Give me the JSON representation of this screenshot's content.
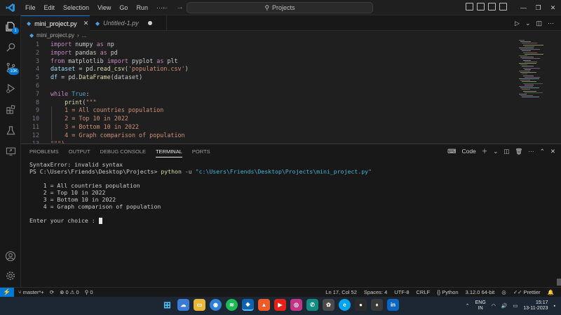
{
  "titlebar": {
    "menu": [
      "File",
      "Edit",
      "Selection",
      "View",
      "Go",
      "Run",
      "···"
    ],
    "search": "Projects"
  },
  "activity": {
    "explorer_badge": "1",
    "scm_badge": "10K"
  },
  "tabs": [
    {
      "label": "mini_project.py",
      "active": true
    },
    {
      "label": "Untitled-1.py",
      "active": false,
      "dirty": true
    }
  ],
  "breadcrumb": {
    "file": "mini_project.py",
    "more": "..."
  },
  "editor": {
    "lines": [
      {
        "n": "1",
        "tokens": [
          [
            "kw",
            "import"
          ],
          [
            "t",
            " numpy "
          ],
          [
            "kw",
            "as"
          ],
          [
            "t",
            " np"
          ]
        ]
      },
      {
        "n": "2",
        "tokens": [
          [
            "kw",
            "import"
          ],
          [
            "t",
            " pandas "
          ],
          [
            "kw",
            "as"
          ],
          [
            "t",
            " pd"
          ]
        ]
      },
      {
        "n": "3",
        "tokens": [
          [
            "kw",
            "from"
          ],
          [
            "t",
            " matplotlib "
          ],
          [
            "kw",
            "import"
          ],
          [
            "t",
            " pyplot "
          ],
          [
            "kw",
            "as"
          ],
          [
            "t",
            " plt"
          ]
        ]
      },
      {
        "n": "4",
        "tokens": [
          [
            "var",
            "dataset"
          ],
          [
            "t",
            " = pd."
          ],
          [
            "fn",
            "read_csv"
          ],
          [
            "t",
            "("
          ],
          [
            "str",
            "'population.csv'"
          ],
          [
            "t",
            ")"
          ]
        ]
      },
      {
        "n": "5",
        "tokens": [
          [
            "var",
            "df"
          ],
          [
            "t",
            " = pd."
          ],
          [
            "fn",
            "DataFrame"
          ],
          [
            "t",
            "(dataset)"
          ]
        ]
      },
      {
        "n": "6",
        "tokens": []
      },
      {
        "n": "7",
        "tokens": [
          [
            "kw",
            "while"
          ],
          [
            "t",
            " "
          ],
          [
            "kwb",
            "True"
          ],
          [
            "t",
            ":"
          ]
        ]
      },
      {
        "n": "8",
        "tokens": [
          [
            "t",
            "    "
          ],
          [
            "fn",
            "print"
          ],
          [
            "t",
            "("
          ],
          [
            "str",
            "\"\"\""
          ]
        ]
      },
      {
        "n": "9",
        "tokens": [
          [
            "str",
            "    1 = All countries population"
          ]
        ]
      },
      {
        "n": "10",
        "tokens": [
          [
            "str",
            "    2 = Top 10 in 2022"
          ]
        ]
      },
      {
        "n": "11",
        "tokens": [
          [
            "str",
            "    3 = Bottom 10 in 2022"
          ]
        ]
      },
      {
        "n": "12",
        "tokens": [
          [
            "str",
            "    4 = Graph comparison of population"
          ]
        ]
      },
      {
        "n": "13",
        "tokens": [
          [
            "str",
            "\"\"\")"
          ]
        ]
      }
    ]
  },
  "panel": {
    "tabs": [
      "PROBLEMS",
      "OUTPUT",
      "DEBUG CONSOLE",
      "TERMINAL",
      "PORTS"
    ],
    "active_tab": "TERMINAL",
    "shell_label": "Code",
    "terminal": {
      "error": "SyntaxError: invalid syntax",
      "prompt": "PS C:\\Users\\Friends\\Desktop\\Projects>",
      "cmd_exe": "python",
      "cmd_flag": "-u",
      "cmd_path": "\"c:\\Users\\Friends\\Desktop\\Projects\\mini_project.py\"",
      "menu": [
        "    1 = All countries population",
        "    2 = Top 10 in 2022",
        "    3 = Bottom 10 in 2022",
        "    4 = Graph comparison of population"
      ],
      "input_prompt": "Enter your choice : "
    }
  },
  "statusbar": {
    "branch": "master*+",
    "problems": "⊗ 0 ⚠ 0",
    "ports": "0",
    "position": "Ln 17, Col 52",
    "spaces": "Spaces: 4",
    "encoding": "UTF-8",
    "eol": "CRLF",
    "language": "Python",
    "interpreter": "3.12.0 64-bit",
    "prettier": "Prettier"
  },
  "taskbar": {
    "lang_top": "ENG",
    "lang_bottom": "IN",
    "time": "15:17",
    "date": "13-11-2023"
  },
  "colors": {
    "accent": "#0078d4",
    "keyword": "#c586c0",
    "string": "#ce9178",
    "function": "#dcdcaa"
  }
}
